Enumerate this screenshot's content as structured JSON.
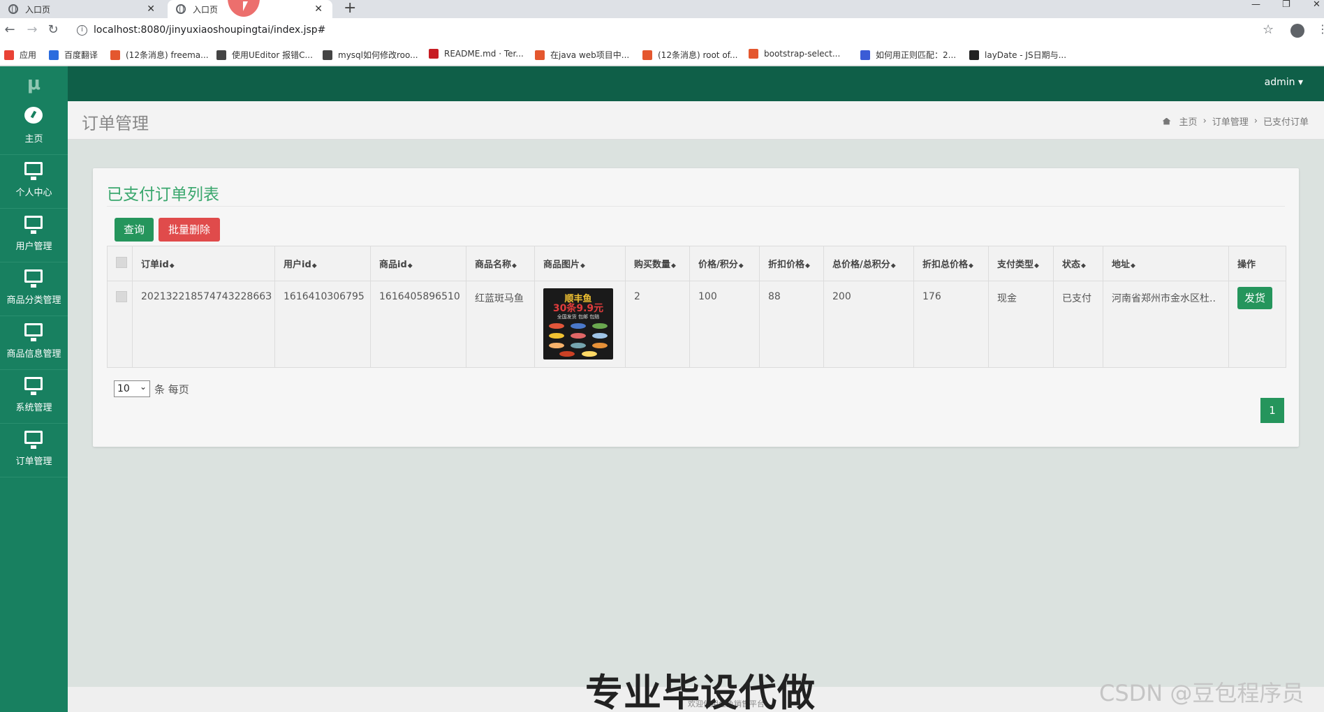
{
  "browser": {
    "tabs": [
      {
        "title": "入口页",
        "active": false
      },
      {
        "title": "入口页",
        "active": true
      }
    ],
    "url": "localhost:8080/jinyuxiaoshoupingtai/index.jsp#",
    "bookmarks": [
      {
        "label": "应用",
        "color": "#e94235"
      },
      {
        "label": "百度翻译",
        "color": "#2b6cde"
      },
      {
        "label": "(12条消息) freema...",
        "color": "#e4572e"
      },
      {
        "label": "使用UEditor 报错C...",
        "color": "#444444"
      },
      {
        "label": "mysql如何修改roo...",
        "color": "#444444"
      },
      {
        "label": "README.md · Ter...",
        "color": "#c71d23"
      },
      {
        "label": "在java web项目中...",
        "color": "#e4572e"
      },
      {
        "label": "(12条消息) root of...",
        "color": "#e4572e"
      },
      {
        "label": "bootstrap-select...",
        "color": "#e4572e"
      },
      {
        "label": "如何用正则匹配：2...",
        "color": "#3b5cd6"
      },
      {
        "label": "layDate - JS日期与...",
        "color": "#222222"
      }
    ]
  },
  "header": {
    "logo": "μ",
    "user": "admin ▾"
  },
  "sidebar": {
    "items": [
      {
        "label": "主页",
        "icon": "dashboard-icon"
      },
      {
        "label": "个人中心",
        "icon": "monitor-icon"
      },
      {
        "label": "用户管理",
        "icon": "monitor-icon"
      },
      {
        "label": "商品分类管理",
        "icon": "monitor-icon"
      },
      {
        "label": "商品信息管理",
        "icon": "monitor-icon"
      },
      {
        "label": "系统管理",
        "icon": "monitor-icon"
      },
      {
        "label": "订单管理",
        "icon": "monitor-icon"
      }
    ]
  },
  "page": {
    "title": "订单管理",
    "breadcrumb": [
      "主页",
      "订单管理",
      "已支付订单"
    ]
  },
  "panel": {
    "title": "已支付订单列表",
    "query_label": "查询",
    "batch_delete_label": "批量删除"
  },
  "table": {
    "columns": [
      "订单id",
      "用户id",
      "商品id",
      "商品名称",
      "商品图片",
      "购买数量",
      "价格/积分",
      "折扣价格",
      "总价格/总积分",
      "折扣总价格",
      "支付类型",
      "状态",
      "地址",
      "操作"
    ],
    "rows": [
      {
        "order_id": "20213221857474322866З",
        "user_id": "1616410306795",
        "product_id": "1616405896510",
        "product_name": "红蓝斑马鱼",
        "image_text_1": "顺丰鱼",
        "image_text_2": "30条9.9元",
        "image_text_3": "全国发货 包邮 包赔",
        "quantity": "2",
        "price": "100",
        "discount_price": "88",
        "total_price": "200",
        "discount_total": "176",
        "pay_type": "现金",
        "status": "已支付",
        "address": "河南省郑州市金水区杜..",
        "action": "发货"
      }
    ]
  },
  "pagination": {
    "page_size": "10",
    "per_page_label": "条 每页",
    "current_page": "1"
  },
  "footer": {
    "text": "欢迎使用金鱼销售平台"
  },
  "overlay": {
    "banner": "专业毕设代做",
    "watermark": "CSDN @豆包程序员"
  }
}
